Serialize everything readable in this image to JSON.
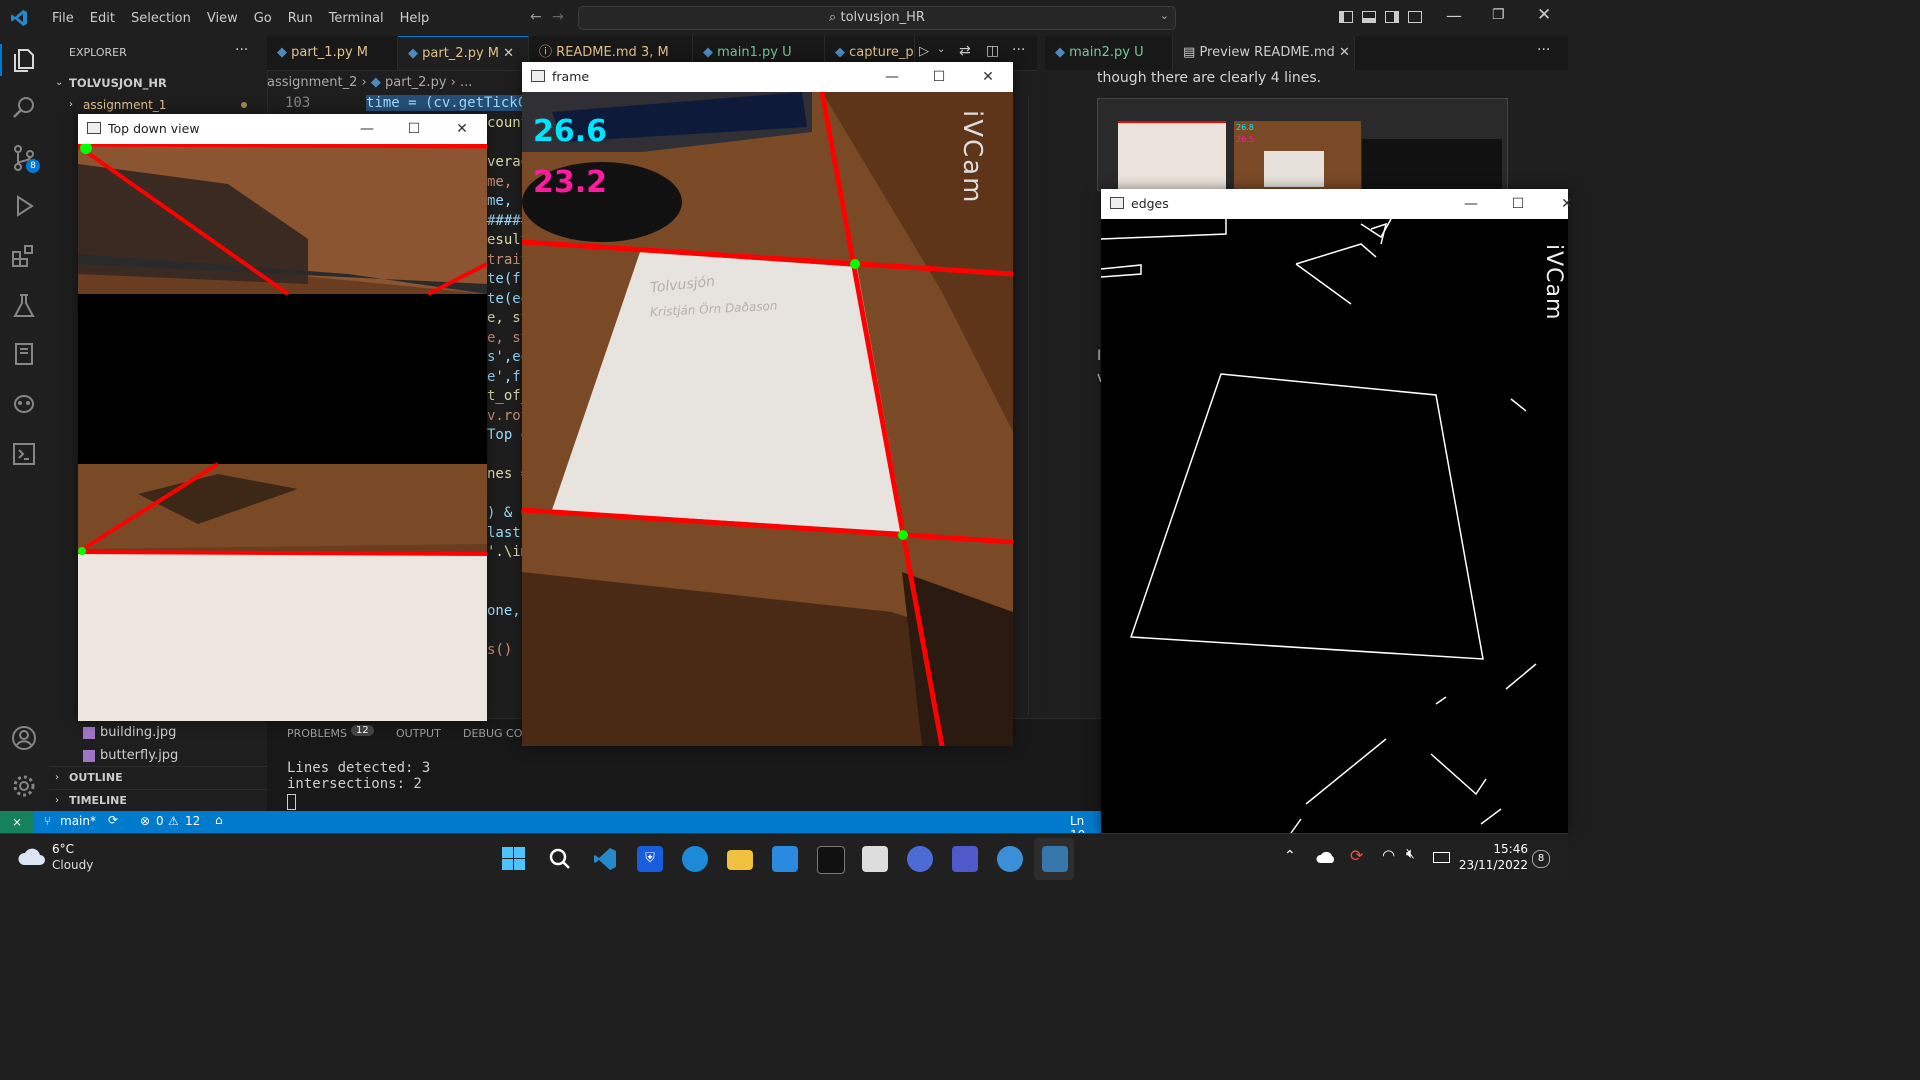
{
  "titlebar": {
    "menu": [
      "File",
      "Edit",
      "Selection",
      "View",
      "Go",
      "Run",
      "Terminal",
      "Help"
    ],
    "search_text": "tolvusjon_HR"
  },
  "activity": {
    "source_control_badge": "8"
  },
  "explorer": {
    "header": "EXPLORER",
    "root": "TOLVUSJON_HR",
    "folder": "assignment_1",
    "files": [
      "building.jpg",
      "butterfly.jpg"
    ],
    "outline": "OUTLINE",
    "timeline": "TIMELINE"
  },
  "tabs": [
    {
      "label": "part_1.py",
      "status": "M"
    },
    {
      "label": "part_2.py",
      "status": "M"
    },
    {
      "label": "README.md",
      "status": "3, M"
    },
    {
      "label": "main1.py",
      "status": "U"
    },
    {
      "label": "capture_p",
      "status": ""
    }
  ],
  "tabs_right": [
    {
      "label": "main2.py",
      "status": "U"
    },
    {
      "label": "Preview README.md",
      "status": ""
    }
  ],
  "breadcrumb": {
    "folder": "assignment_2",
    "file": "part_2.py",
    "rest": "..."
  },
  "code": {
    "line_number": "103",
    "line_text": "time = (cv.getTickCo",
    "line2": "count",
    "fragments": [
      "verag",
      "me, s",
      "me, s",
      "#####",
      "esult",
      "trait",
      "te(fr",
      "te(ed",
      "e, st",
      "e, st",
      "s',ed",
      "e',fr",
      "t_of_",
      "v.rot",
      "Top d",
      "",
      "nes =",
      "",
      ") & 0",
      "last",
      "'.\\im",
      "",
      "",
      "one,",
      "",
      "s()"
    ]
  },
  "panel": {
    "tabs": [
      "PROBLEMS",
      "OUTPUT",
      "DEBUG CON"
    ],
    "problems_count": "12",
    "terminal": [
      "Lines detected: 3",
      "intersections: 2"
    ]
  },
  "status": {
    "branch": "main*",
    "errors": "0",
    "warnings": "12",
    "position": "Ln 10"
  },
  "preview": {
    "text": "though there are clearly 4 lines."
  },
  "windows": {
    "topdown": {
      "title": "Top down view"
    },
    "frame": {
      "title": "frame",
      "fps1": "26.6",
      "fps2": "23.2",
      "watermark": "iVCam",
      "paper_line1": "Tolvusjón",
      "paper_line2": "Kristján Örn Daðason"
    },
    "edges": {
      "title": "edges",
      "watermark": "iVCam"
    },
    "thumb": {
      "fps1": "26.8",
      "fps2": "26.5"
    }
  },
  "taskbar": {
    "weather_temp": "6°C",
    "weather_text": "Cloudy",
    "time": "15:46",
    "date": "23/11/2022",
    "notif": "8"
  },
  "colors": {
    "accent": "#007acc",
    "line_red": "#ff0000",
    "point_green": "#00ff00",
    "fps_cyan": "#00e5ff",
    "fps_magenta": "#ff1aa0"
  }
}
